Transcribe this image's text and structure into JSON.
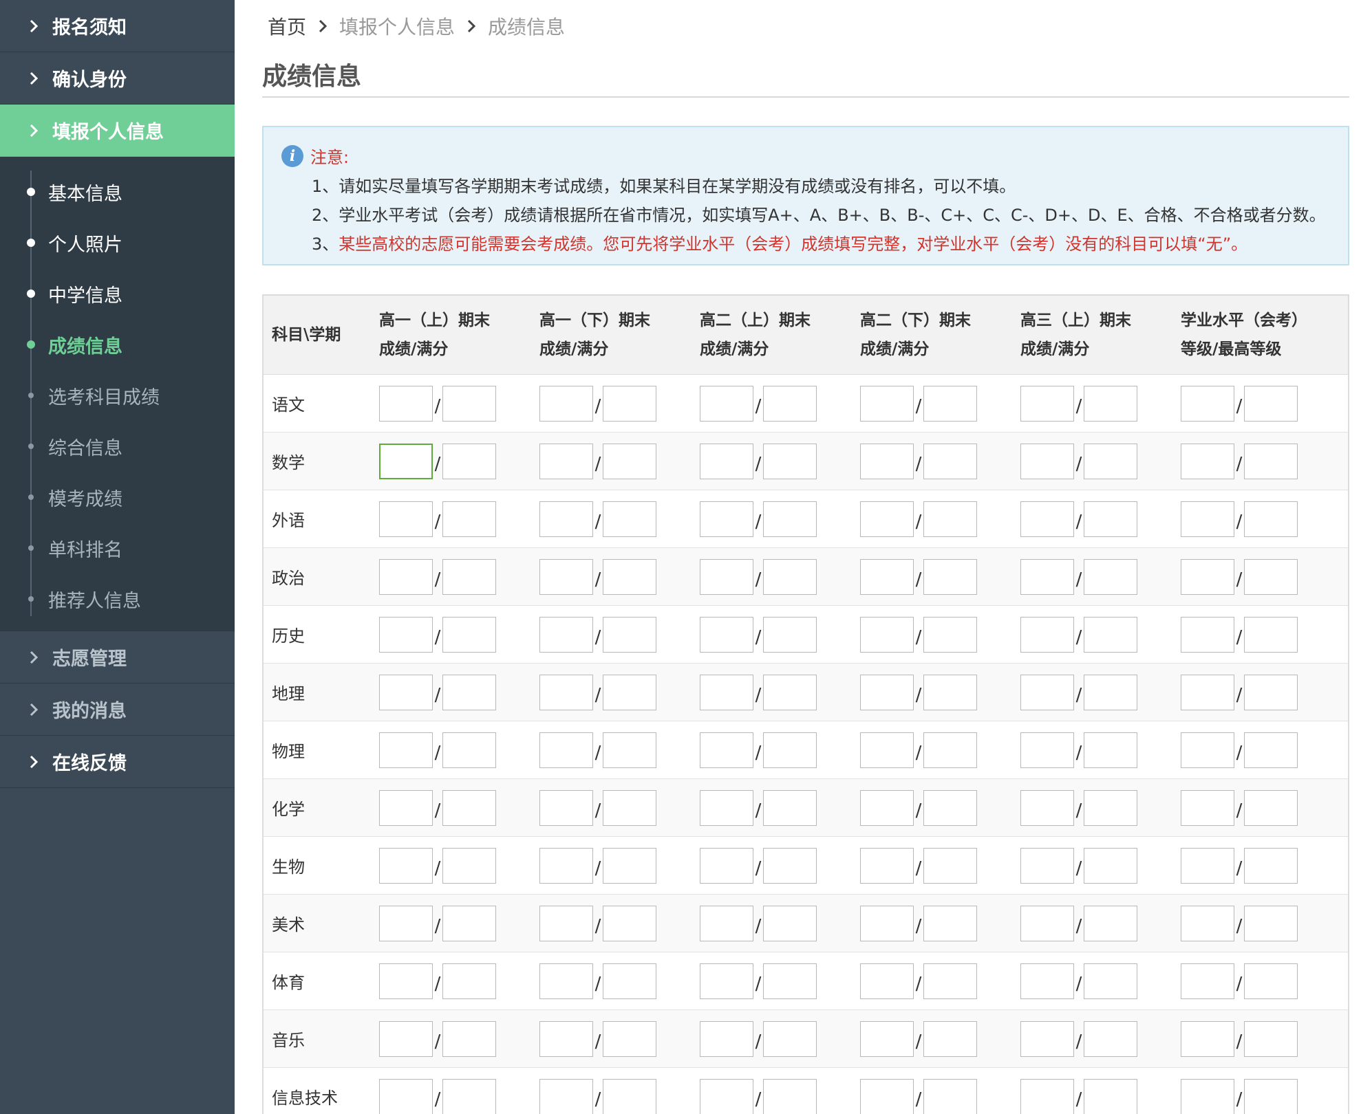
{
  "sidebar": {
    "top_items": [
      {
        "label": "报名须知"
      },
      {
        "label": "确认身份"
      },
      {
        "label": "填报个人信息"
      }
    ],
    "sub_items": [
      {
        "label": "基本信息"
      },
      {
        "label": "个人照片"
      },
      {
        "label": "中学信息"
      },
      {
        "label": "成绩信息"
      },
      {
        "label": "选考科目成绩"
      },
      {
        "label": "综合信息"
      },
      {
        "label": "模考成绩"
      },
      {
        "label": "单科排名"
      },
      {
        "label": "推荐人信息"
      }
    ],
    "bottom_items": [
      {
        "label": "志愿管理"
      },
      {
        "label": "我的消息"
      },
      {
        "label": "在线反馈"
      }
    ]
  },
  "breadcrumb": {
    "home": "首页",
    "level1": "填报个人信息",
    "level2": "成绩信息"
  },
  "page_title": "成绩信息",
  "notice": {
    "heading": "注意:",
    "line1": "1、请如实尽量填写各学期期末考试成绩，如果某科目在某学期没有成绩或没有排名，可以不填。",
    "line2": "2、学业水平考试（会考）成绩请根据所在省市情况，如实填写A+、A、B+、B、B-、C+、C、C-、D+、D、E、合格、不合格或者分数。",
    "line3_num": "3、",
    "line3_text": "某些高校的志愿可能需要会考成绩。您可先将学业水平（会考）成绩填写完整，对学业水平（会考）没有的科目可以填“无”。"
  },
  "table": {
    "corner": "科目\\学期",
    "columns": [
      {
        "line1": "高一（上）期末",
        "line2": "成绩/满分"
      },
      {
        "line1": "高一（下）期末",
        "line2": "成绩/满分"
      },
      {
        "line1": "高二（上）期末",
        "line2": "成绩/满分"
      },
      {
        "line1": "高二（下）期末",
        "line2": "成绩/满分"
      },
      {
        "line1": "高三（上）期末",
        "line2": "成绩/满分"
      },
      {
        "line1": "学业水平（会考）",
        "line2": "等级/最高等级"
      }
    ],
    "separator": "/",
    "subjects": [
      "语文",
      "数学",
      "外语",
      "政治",
      "历史",
      "地理",
      "物理",
      "化学",
      "生物",
      "美术",
      "体育",
      "音乐",
      "信息技术"
    ]
  },
  "colors": {
    "sidebar_bg": "#3b4a56",
    "active_green": "#6fcf97",
    "notice_red": "#d0342c",
    "notice_bg": "#e8f3f9"
  }
}
